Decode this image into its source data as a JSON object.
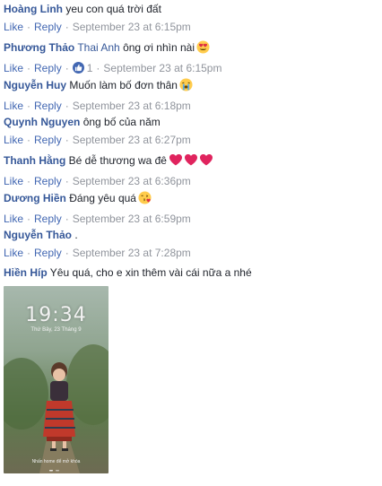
{
  "actions": {
    "like": "Like",
    "reply": "Reply"
  },
  "comments": [
    {
      "author": "Hoàng Linh",
      "text": "yeu con quá trời đất",
      "time": "September 23 at 6:15pm"
    },
    {
      "author": "Phương Thảo",
      "mention": "Thai Anh",
      "text": "ông ơi nhìn nài",
      "emoji": "heart-eyes-emoji",
      "time": "September 23 at 6:15pm",
      "reaction": {
        "icon": "thumbs-up-icon",
        "count": "1"
      }
    },
    {
      "author": "Nguyễn Huy",
      "text": "Muốn làm bố đơn thân",
      "emoji": "loudly-crying-emoji",
      "time": "September 23 at 6:18pm"
    },
    {
      "author": "Quynh Nguyen",
      "text": "ông bố của năm",
      "time": "September 23 at 6:27pm"
    },
    {
      "author": "Thanh Hằng",
      "text": "Bé dễ thương wa đê",
      "emoji": "three-red-hearts-emoji",
      "time": "September 23 at 6:36pm"
    },
    {
      "author": "Dương Hiền",
      "text": "Đáng yêu quá",
      "emoji": "face-blowing-kiss-emoji",
      "time": "September 23 at 6:59pm"
    },
    {
      "author": "Nguyễn Thảo",
      "text": ".",
      "time": "September 23 at 7:28pm"
    },
    {
      "author": "Hiền Híp",
      "text": "Yêu quá, cho e xin thêm vài cái nữa a nhé"
    }
  ],
  "photo": {
    "clock": "19:34",
    "date": "Thứ Bảy, 23 Tháng 9",
    "unlock_text": "Nhấn home để mở khóa"
  }
}
